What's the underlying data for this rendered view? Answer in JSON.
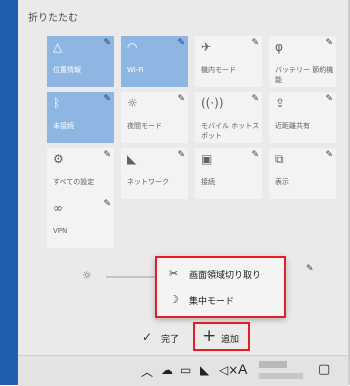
{
  "panel": {
    "collapse_label": "折りたたむ"
  },
  "tiles": [
    {
      "label": "位置情報",
      "icon": "location-icon",
      "glyph": "△",
      "active": true
    },
    {
      "label": "Wi-Fi",
      "icon": "wifi-icon",
      "glyph": "◠",
      "active": true
    },
    {
      "label": "機内モード",
      "icon": "airplane-icon",
      "glyph": "✈",
      "active": false
    },
    {
      "label": "バッテリー 節約機能",
      "icon": "battery-saver-icon",
      "glyph": "φ",
      "active": false
    },
    {
      "label": "未接続",
      "icon": "bluetooth-icon",
      "glyph": "ᛒ",
      "active": true
    },
    {
      "label": "夜間モード",
      "icon": "night-light-icon",
      "glyph": "☼",
      "active": false
    },
    {
      "label": "モバイル ホットスポット",
      "icon": "hotspot-icon",
      "glyph": "((·))",
      "active": false
    },
    {
      "label": "近距離共有",
      "icon": "nearby-share-icon",
      "glyph": "⇪",
      "active": false
    },
    {
      "label": "すべての設定",
      "icon": "settings-icon",
      "glyph": "⚙",
      "active": false
    },
    {
      "label": "ネットワーク",
      "icon": "network-icon",
      "glyph": "◣",
      "active": false
    },
    {
      "label": "接続",
      "icon": "connect-icon",
      "glyph": "▣",
      "active": false
    },
    {
      "label": "表示",
      "icon": "project-icon",
      "glyph": "⧉",
      "active": false
    },
    {
      "label": "VPN",
      "icon": "vpn-icon",
      "glyph": "∞",
      "active": false
    }
  ],
  "add_menu": {
    "items": [
      {
        "label": "画面領域切り取り",
        "icon": "snip-icon"
      },
      {
        "label": "集中モード",
        "icon": "focus-assist-icon"
      }
    ]
  },
  "footer": {
    "done_label": "完了",
    "add_label": "追加"
  },
  "taskbar": {
    "input_indicator": "A"
  },
  "colors": {
    "accent": "#1f5fae",
    "tile_active": "#8db6e3",
    "highlight_border": "#e51d24"
  }
}
